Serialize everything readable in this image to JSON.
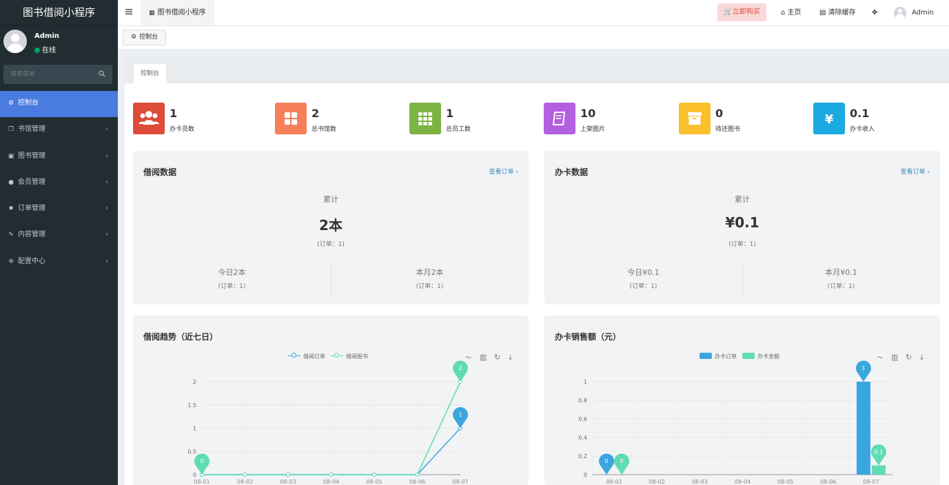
{
  "app": {
    "title": "图书借阅小程序"
  },
  "user": {
    "name": "Admin",
    "status": "在线"
  },
  "search": {
    "placeholder": "搜索菜单"
  },
  "menu": [
    {
      "label": "控制台",
      "icon": "dashboard-icon",
      "glyph": "⚙"
    },
    {
      "label": "书馆管理",
      "icon": "clone-icon",
      "glyph": "❐"
    },
    {
      "label": "图书管理",
      "icon": "book-icon",
      "glyph": "▣"
    },
    {
      "label": "会员管理",
      "icon": "user-circle-icon",
      "glyph": "●"
    },
    {
      "label": "订单管理",
      "icon": "gear-icon",
      "glyph": "✹"
    },
    {
      "label": "内容管理",
      "icon": "edit-icon",
      "glyph": "✎"
    },
    {
      "label": "配置中心",
      "icon": "cog-icon",
      "glyph": "✲"
    }
  ],
  "topbar": {
    "tab": "图书借阅小程序",
    "buy": "立即购买",
    "home": "主页",
    "clear_cache": "清除缓存",
    "user": "Admin"
  },
  "breadcrumb": "控制台",
  "panel_tab": "控制台",
  "stats": [
    {
      "value": "1",
      "label": "办卡员数",
      "color": "#dd4b39",
      "icon": "users-icon"
    },
    {
      "value": "2",
      "label": "总书馆数",
      "color": "#f5805a",
      "icon": "grid-icon"
    },
    {
      "value": "1",
      "label": "总员工数",
      "color": "#7cb342",
      "icon": "apps-icon"
    },
    {
      "value": "10",
      "label": "上架图片",
      "color": "#b25fe0",
      "icon": "book-icon"
    },
    {
      "value": "0",
      "label": "待还图书",
      "color": "#fbc02d",
      "icon": "archive-icon"
    },
    {
      "value": "0.1",
      "label": "办卡收入",
      "color": "#1aa9e0",
      "icon": "yen-icon"
    }
  ],
  "borrow_card": {
    "title": "借阅数据",
    "link": "查看订单 ›",
    "total_label": "累计",
    "total_value": "2本",
    "total_orders": "(订单：1)",
    "today": "今日2本",
    "today_orders": "(订单：1)",
    "month": "本月2本",
    "month_orders": "(订单：1)"
  },
  "card_card": {
    "title": "办卡数据",
    "link": "查看订单 ›",
    "total_label": "累计",
    "total_value": "¥0.1",
    "total_orders": "(订单：1)",
    "today": "今日¥0.1",
    "today_orders": "(订单：1)",
    "month": "本月¥0.1",
    "month_orders": "(订单：1)"
  },
  "chart_data": [
    {
      "type": "line",
      "title": "借阅趋势（近七日）",
      "categories": [
        "08-01",
        "08-02",
        "08-03",
        "08-04",
        "08-05",
        "08-06",
        "08-07"
      ],
      "series": [
        {
          "name": "借阅订单",
          "values": [
            0,
            0,
            0,
            0,
            0,
            0,
            1
          ],
          "color": "#3ba5dd"
        },
        {
          "name": "借阅图书",
          "values": [
            0,
            0,
            0,
            0,
            0,
            0,
            2
          ],
          "color": "#5fdcb3"
        }
      ],
      "yticks": [
        "0",
        "0.5",
        "1",
        "1.5",
        "2"
      ],
      "ylim": [
        0,
        2
      ],
      "markers": [
        {
          "series": 1,
          "index": 0,
          "label": "0"
        },
        {
          "series": 1,
          "index": 6,
          "label": "2"
        },
        {
          "series": 0,
          "index": 6,
          "label": "1"
        }
      ]
    },
    {
      "type": "bar",
      "title": "办卡销售额（元）",
      "categories": [
        "08-01",
        "08-02",
        "08-03",
        "08-04",
        "08-05",
        "08-06",
        "08-07"
      ],
      "series": [
        {
          "name": "办卡订单",
          "values": [
            0,
            0,
            0,
            0,
            0,
            0,
            1
          ],
          "color": "#3ba5dd"
        },
        {
          "name": "办卡金额",
          "values": [
            0,
            0,
            0,
            0,
            0,
            0,
            0.1
          ],
          "color": "#5fdcb3"
        }
      ],
      "yticks": [
        "0",
        "0.2",
        "0.4",
        "0.6",
        "0.8",
        "1"
      ],
      "ylim": [
        0,
        1
      ],
      "markers": [
        {
          "series": 0,
          "index": 0,
          "label": "0"
        },
        {
          "series": 1,
          "index": 0,
          "label": "0"
        },
        {
          "series": 0,
          "index": 6,
          "label": "1"
        },
        {
          "series": 1,
          "index": 6,
          "label": "0.1"
        }
      ]
    }
  ]
}
